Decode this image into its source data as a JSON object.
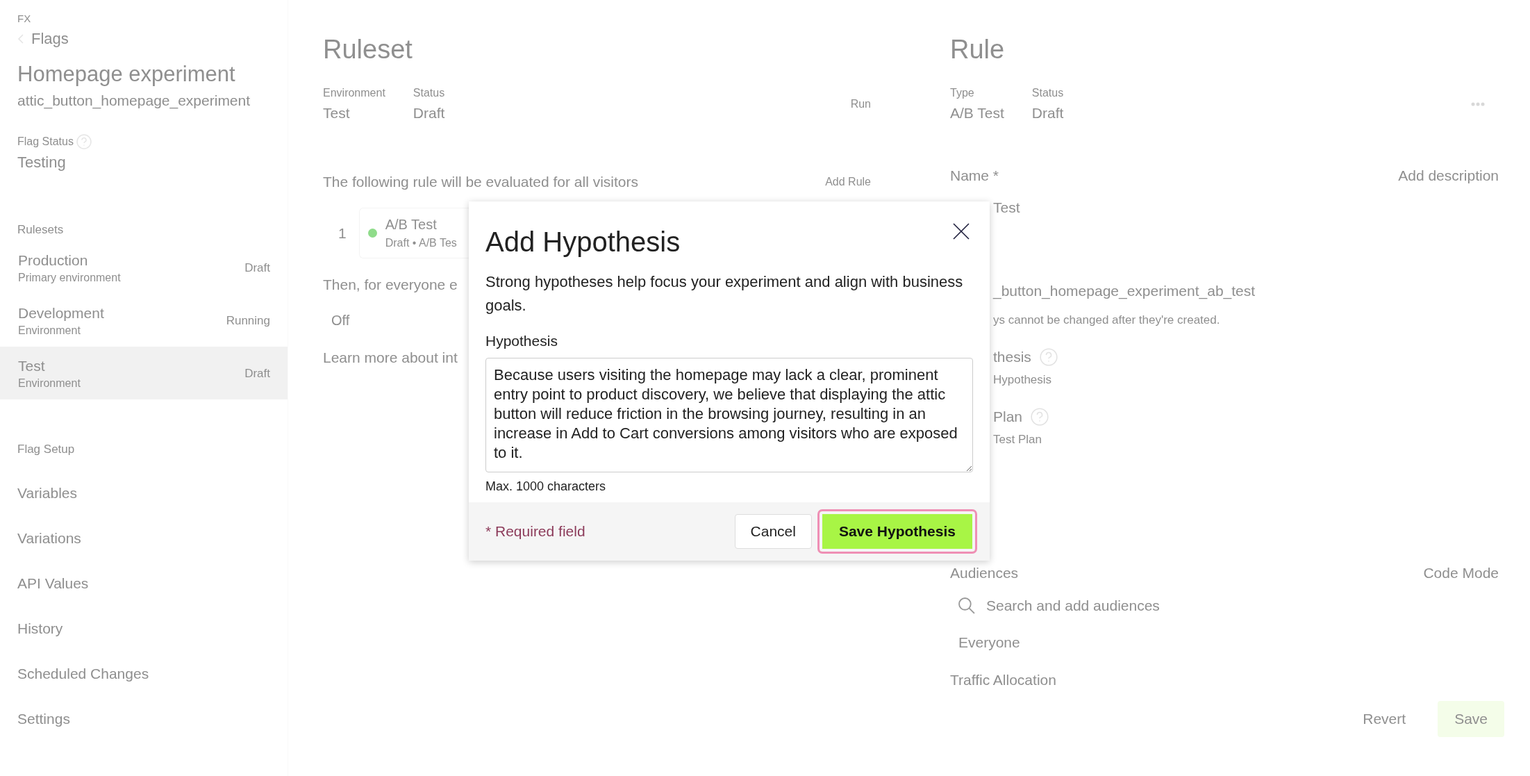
{
  "sidebar": {
    "product": "FX",
    "back": {
      "label": "Flags"
    },
    "title": "Homepage experiment",
    "key": "attic_button_homepage_experiment",
    "flag_status": {
      "label": "Flag Status",
      "value": "Testing"
    },
    "rulesets_heading": "Rulesets",
    "rulesets": [
      {
        "name": "Production",
        "description": "Primary environment",
        "status": "Draft",
        "selected": false
      },
      {
        "name": "Development",
        "description": "Environment",
        "status": "Running",
        "selected": false
      },
      {
        "name": "Test",
        "description": "Environment",
        "status": "Draft",
        "selected": true
      }
    ],
    "setup_heading": "Flag Setup",
    "setup_items": [
      "Variables",
      "Variations",
      "API Values",
      "History",
      "Scheduled Changes",
      "Settings"
    ]
  },
  "ruleset": {
    "title": "Ruleset",
    "meta": [
      {
        "label": "Environment",
        "value": "Test"
      },
      {
        "label": "Status",
        "value": "Draft"
      }
    ],
    "run_button": "Run",
    "intro": "The following rule will be evaluated for all visitors",
    "add_rule": "Add Rule",
    "rules": [
      {
        "index": "1",
        "name": "A/B Test",
        "detail": "Draft • A/B Tes",
        "color": "#8fdc8a"
      }
    ],
    "fallback_intro": "Then, for everyone e",
    "fallback_value": "Off",
    "learn_more": "Learn more about int"
  },
  "rule": {
    "title": "Rule",
    "meta": [
      {
        "label": "Type",
        "value": "A/B Test"
      },
      {
        "label": "Status",
        "value": "Draft"
      }
    ],
    "name_label": "Name *",
    "add_description": "Add description",
    "name_value": "Test",
    "key_value": "_button_homepage_experiment_ab_test",
    "key_note": "ys cannot be changed after they're created.",
    "hypothesis_label": "thesis",
    "hypothesis_link": "Hypothesis",
    "plan_label": "Plan",
    "plan_link": "Test Plan",
    "audiences_label": "Audiences",
    "code_mode": "Code Mode",
    "search": {
      "placeholder": "Search and add audiences"
    },
    "audience": "Everyone",
    "traffic_label": "Traffic Allocation",
    "revert_button": "Revert",
    "save_button": "Save"
  },
  "dialog": {
    "title": "Add Hypothesis",
    "description": "Strong hypotheses help focus your experiment and align with business goals.",
    "field_label": "Hypothesis",
    "value": "Because users visiting the homepage may lack a clear, prominent entry point to product discovery, we believe that displaying the attic button will reduce friction in the browsing journey, resulting in an increase in Add to Cart conversions among visitors who are exposed to it.",
    "helper": "Max. 1000 characters",
    "required_note": "* Required field",
    "cancel_button": "Cancel",
    "save_button": {
      "label": "Save Hypothesis",
      "focused": true
    }
  }
}
